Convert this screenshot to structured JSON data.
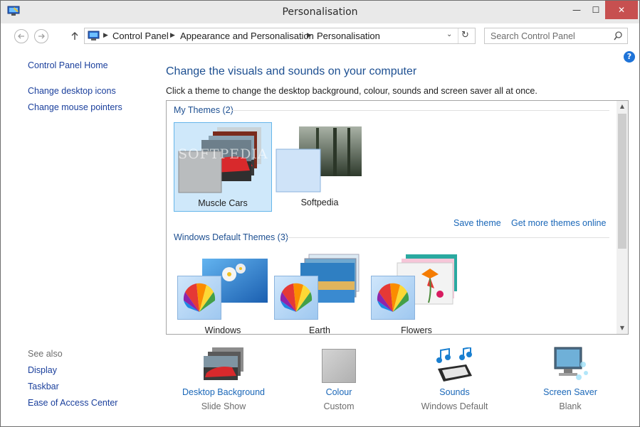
{
  "window": {
    "title": "Personalisation",
    "controls": {
      "minimize": "—",
      "maximize": "☐",
      "close": "✕"
    }
  },
  "navigation": {
    "back_icon": "arrow-left-icon",
    "forward_icon": "arrow-right-icon",
    "up_icon": "arrow-up-icon",
    "breadcrumb": [
      "Control Panel",
      "Appearance and Personalisation",
      "Personalisation"
    ],
    "search_placeholder": "Search Control Panel"
  },
  "sidebar": {
    "home": "Control Panel Home",
    "links": [
      "Change desktop icons",
      "Change mouse pointers"
    ],
    "see_also_title": "See also",
    "see_also": [
      "Display",
      "Taskbar",
      "Ease of Access Center"
    ]
  },
  "main": {
    "heading": "Change the visuals and sounds on your computer",
    "description": "Click a theme to change the desktop background, colour, sounds and screen saver all at once.",
    "my_themes_title": "My Themes (2)",
    "my_themes": [
      {
        "name": "Muscle Cars",
        "selected": true
      },
      {
        "name": "Softpedia",
        "selected": false
      }
    ],
    "save_theme": "Save theme",
    "get_more_themes": "Get more themes online",
    "default_themes_title": "Windows Default Themes (3)",
    "default_themes": [
      {
        "name": "Windows"
      },
      {
        "name": "Earth"
      },
      {
        "name": "Flowers"
      }
    ],
    "watermark": "SOFTPEDIA"
  },
  "bottom": [
    {
      "label": "Desktop Background",
      "value": "Slide Show",
      "icon": "desktop-background-icon"
    },
    {
      "label": "Colour",
      "value": "Custom",
      "icon": "colour-icon"
    },
    {
      "label": "Sounds",
      "value": "Windows Default",
      "icon": "sounds-icon"
    },
    {
      "label": "Screen Saver",
      "value": "Blank",
      "icon": "screen-saver-icon"
    }
  ],
  "colors": {
    "accent": "#1d4f91",
    "link": "#1a3f9c",
    "selection": "#cfe8fa",
    "close_button": "#c75050"
  }
}
